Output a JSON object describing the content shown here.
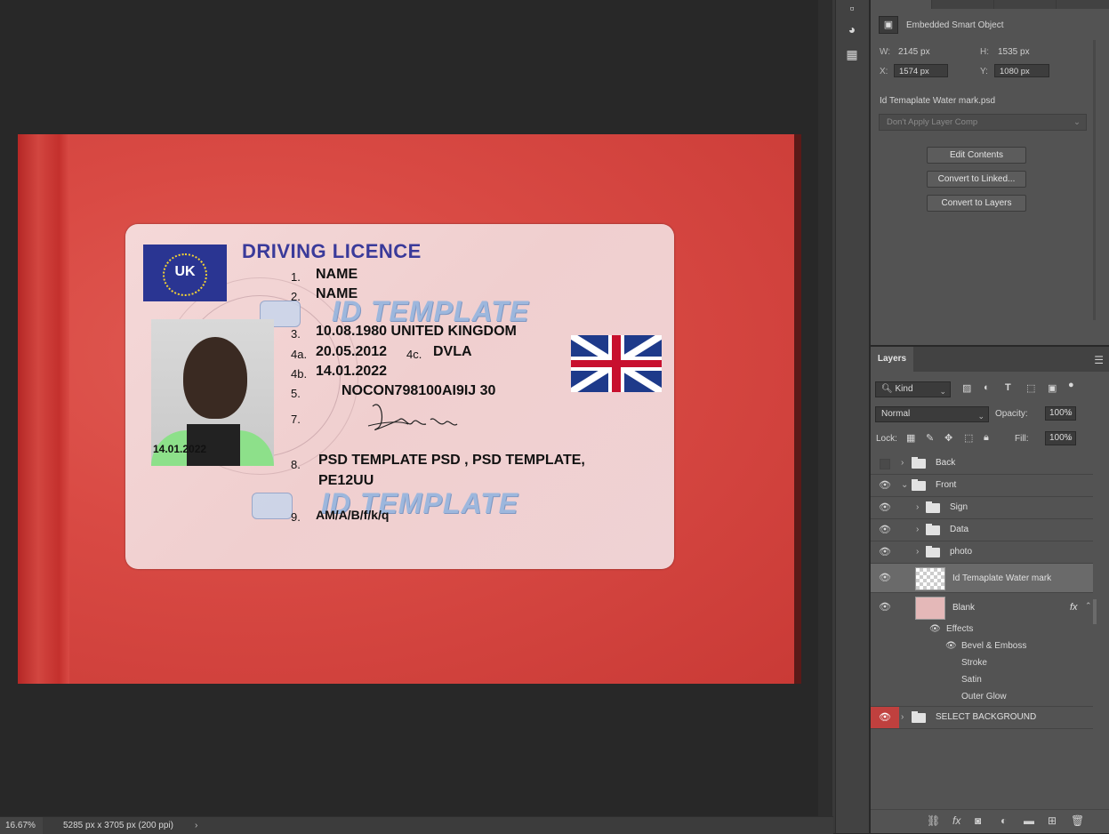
{
  "document": {
    "card": {
      "title": "DRIVING LICENCE",
      "flag_label": "UK",
      "photo_date": "14.01.2022",
      "fields": [
        {
          "num": "1.",
          "value": "NAME"
        },
        {
          "num": "2.",
          "value": "NAME"
        },
        {
          "num": "3.",
          "value": "10.08.1980  UNITED KINGDOM"
        },
        {
          "num": "4a.",
          "value": "20.05.2012"
        },
        {
          "num": "4c.",
          "value": "DVLA"
        },
        {
          "num": "4b.",
          "value": "14.01.2022"
        },
        {
          "num": "5.",
          "value": "NOCON798100AI9IJ 30"
        },
        {
          "num": "7.",
          "value": ""
        },
        {
          "num": "8.",
          "value": "PSD TEMPLATE PSD , PSD TEMPLATE,"
        },
        {
          "num": "",
          "value": "PE12UU"
        },
        {
          "num": "9.",
          "value": "AM/A/B/f/k/q"
        }
      ],
      "watermark": "ID TEMPLATE"
    }
  },
  "properties": {
    "type_label": "Embedded Smart Object",
    "w_label": "W:",
    "w_value": "2145 px",
    "h_label": "H:",
    "h_value": "1535 px",
    "x_label": "X:",
    "x_value": "1574 px",
    "y_label": "Y:",
    "y_value": "1080 px",
    "filename": "Id Temaplate Water mark.psd",
    "layer_comp": "Don't Apply Layer Comp",
    "buttons": [
      "Edit Contents",
      "Convert to Linked...",
      "Convert to Layers"
    ]
  },
  "layers_panel": {
    "tab": "Layers",
    "filter_kind": "Kind",
    "blend_mode": "Normal",
    "opacity_label": "Opacity:",
    "opacity": "100%",
    "lock_label": "Lock:",
    "fill_label": "Fill:",
    "fill": "100%",
    "layers": [
      {
        "name": "Back",
        "visible": false
      },
      {
        "name": "Front",
        "visible": true
      },
      {
        "name": "Sign",
        "visible": true
      },
      {
        "name": "Data",
        "visible": true
      },
      {
        "name": "photo",
        "visible": true
      },
      {
        "name": "Id Temaplate Water mark",
        "visible": true
      },
      {
        "name": "Blank",
        "visible": true
      },
      {
        "name": "SELECT BACKGROUND",
        "visible": true
      }
    ],
    "effects_label": "Effects",
    "effects": [
      "Bevel & Emboss",
      "Stroke",
      "Satin",
      "Outer Glow"
    ],
    "fx_label": "fx"
  },
  "status_bar": {
    "zoom": "16.67%",
    "doc_info": "5285 px x 3705 px (200 ppi)"
  },
  "colors": {
    "accent_eye_red": "#c0403e",
    "panel_bg": "#535353"
  }
}
